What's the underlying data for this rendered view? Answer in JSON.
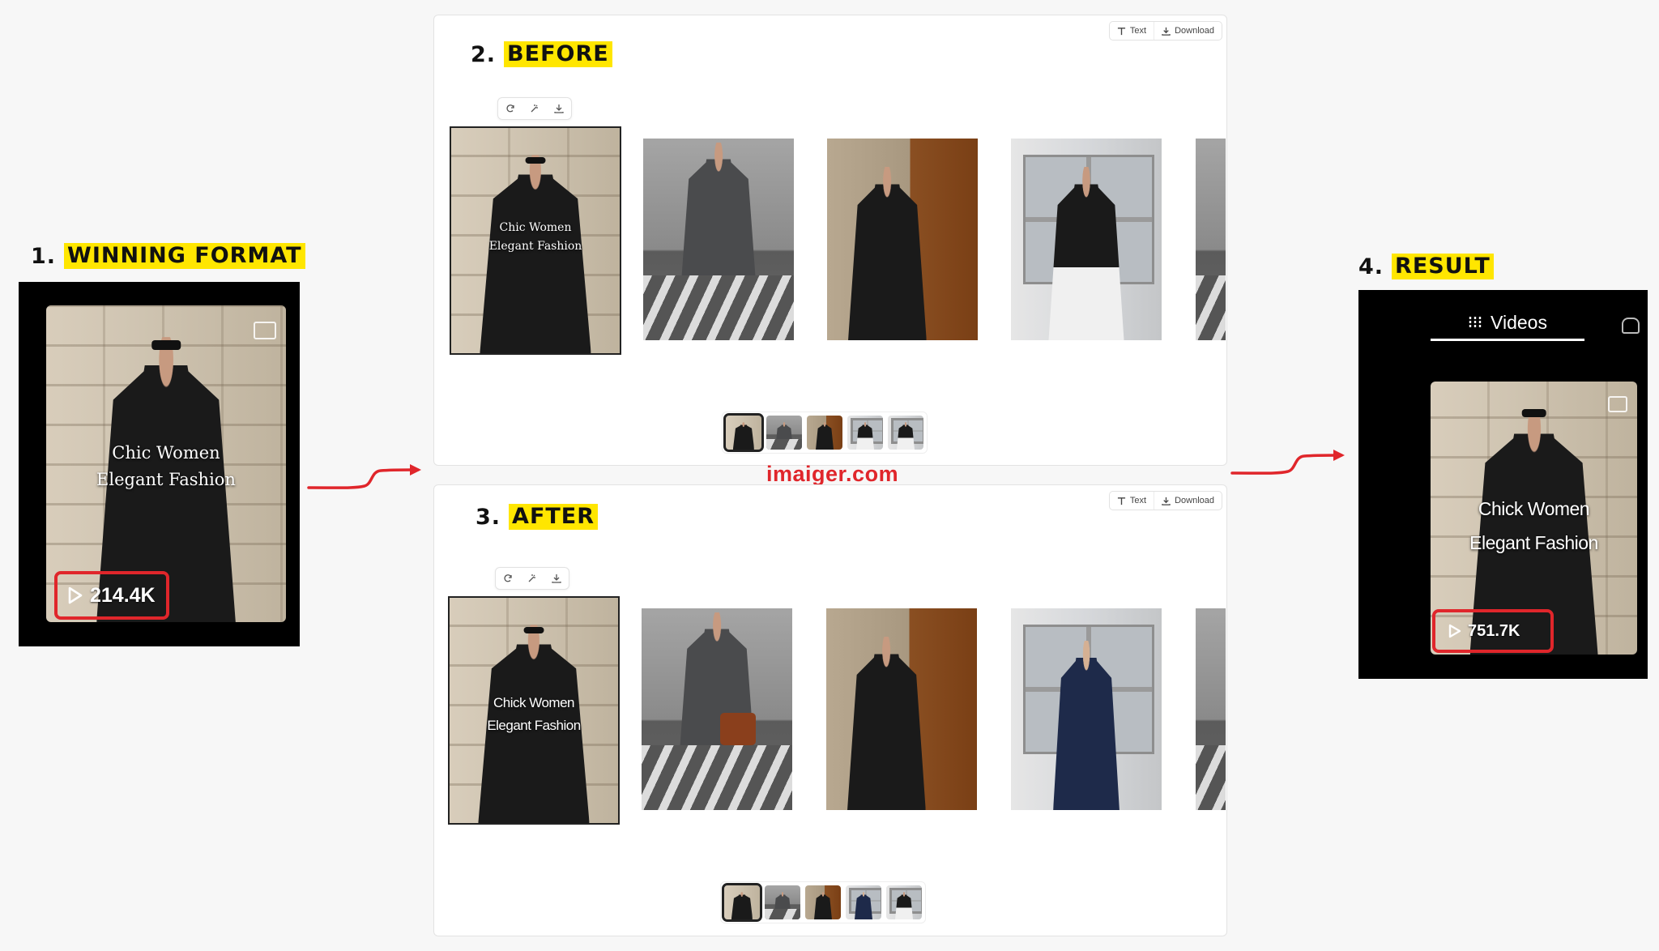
{
  "steps": {
    "one": {
      "num": "1.",
      "label": "WINNING FORMAT"
    },
    "two": {
      "num": "2.",
      "label": "BEFORE"
    },
    "three": {
      "num": "3.",
      "label": "AFTER"
    },
    "four": {
      "num": "4.",
      "label": "RESULT"
    }
  },
  "winning": {
    "caption_line1": "Chic Women",
    "caption_line2": "Elegant Fashion",
    "views": "214.4K"
  },
  "before": {
    "toolbar": {
      "text_label": "Text",
      "download_label": "Download"
    },
    "caption_line1": "Chic Women",
    "caption_line2": "Elegant Fashion"
  },
  "after": {
    "toolbar": {
      "text_label": "Text",
      "download_label": "Download"
    },
    "caption_line1": "Chick Women",
    "caption_line2": "Elegant Fashion"
  },
  "result": {
    "tab_label": "Videos",
    "caption_line1": "Chick Women",
    "caption_line2": "Elegant Fashion",
    "views": "751.7K"
  },
  "watermark": "imaiger.com",
  "colors": {
    "highlight": "#ffe600",
    "annotation_red": "#e0262b",
    "dark_panel": "#000000"
  },
  "icons": [
    "play-icon",
    "refresh-icon",
    "magic-icon",
    "download-icon",
    "text-icon",
    "gallery-icon",
    "videos-icon",
    "arrow-icon"
  ]
}
